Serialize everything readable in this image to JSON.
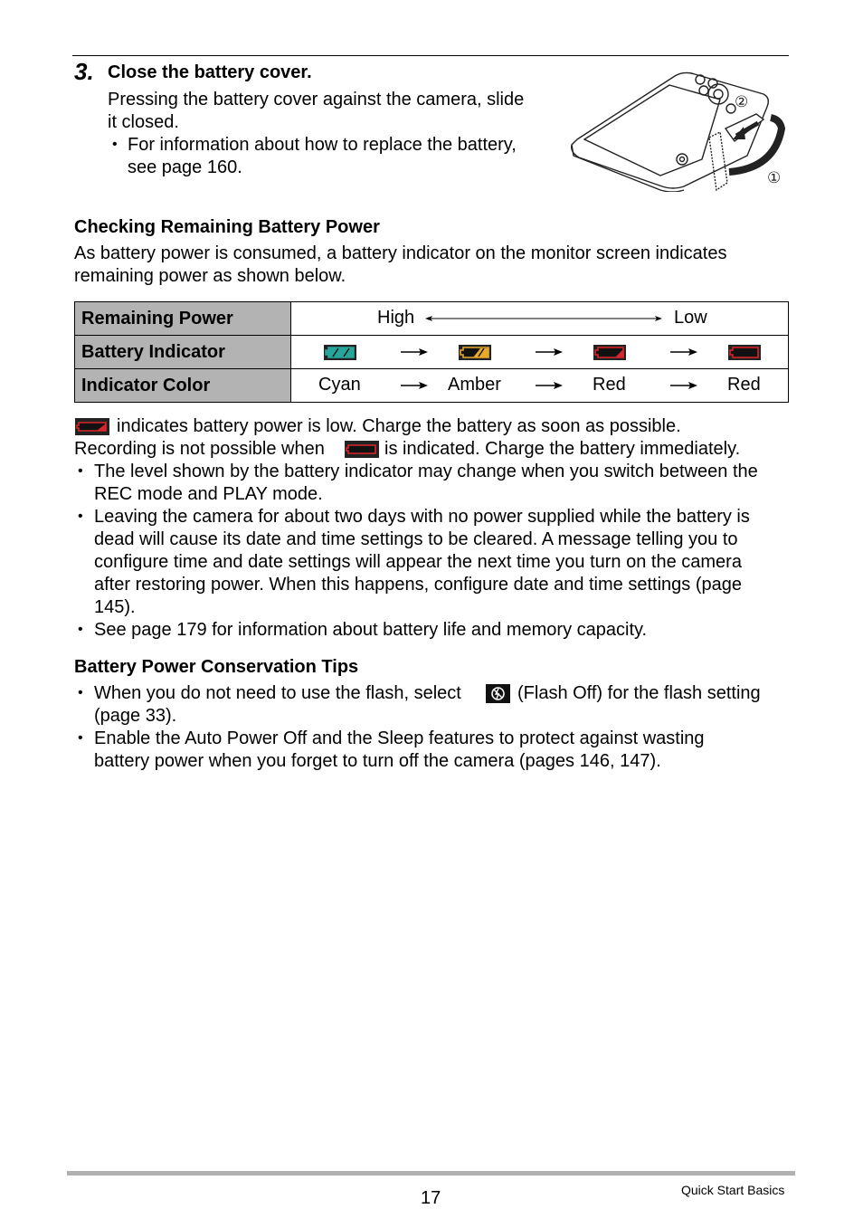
{
  "step": {
    "number": "3.",
    "title": "Close the battery cover.",
    "body_lines": [
      "Pressing the battery cover against the camera, slide",
      "it closed."
    ],
    "bullet_lines": [
      "For information about how to replace the battery,",
      "see page 160."
    ],
    "illustration": {
      "description": "camera-battery-cover-closing",
      "callouts": [
        "②",
        "①"
      ]
    }
  },
  "checking": {
    "heading": "Checking Remaining Battery Power",
    "intro_lines": [
      "As battery power is consumed, a battery indicator on the monitor screen indicates",
      "remaining power as shown below."
    ]
  },
  "table": {
    "rows": [
      {
        "header": "Remaining Power",
        "high": "High",
        "low": "Low"
      },
      {
        "header": "Battery Indicator",
        "indicators": [
          {
            "name": "battery-full-icon",
            "color": "#27a59a",
            "level": "full"
          },
          {
            "name": "battery-two-thirds-icon",
            "color": "#e8a92a",
            "level": "two-thirds"
          },
          {
            "name": "battery-low-icon",
            "color": "#d9252b",
            "level": "low"
          },
          {
            "name": "battery-empty-icon",
            "color": "#d9252b",
            "level": "empty"
          }
        ]
      },
      {
        "header": "Indicator Color",
        "colors": [
          "Cyan",
          "Amber",
          "Red",
          "Red"
        ]
      }
    ]
  },
  "notes": {
    "line1_after_icon": "indicates battery power is low. Charge the battery as soon as possible.",
    "line2_before_icon": "Recording is not possible when",
    "line2_after_icon": "is indicated. Charge the battery immediately.",
    "bullets": [
      [
        "The level shown by the battery indicator may change when you switch between the",
        "REC mode and PLAY mode."
      ],
      [
        "Leaving the camera for about two days with no power supplied while the battery is",
        "dead will cause its date and time settings to be cleared. A message telling you to",
        "configure time and date settings will appear the next time you turn on the camera",
        "after restoring power. When this happens, configure date and time settings (page",
        "145)."
      ],
      [
        "See page 179 for information about battery life and memory capacity."
      ]
    ]
  },
  "tips": {
    "heading": "Battery Power Conservation Tips",
    "bullet1_before_icon": "When you do not need to use the flash, select",
    "bullet1_after_icon": "(Flash Off) for the flash setting",
    "bullet1_line2": "(page 33).",
    "bullet2": [
      "Enable the Auto Power Off and the Sleep features to protect against wasting",
      "battery power when you forget to turn off the camera (pages 146, 147)."
    ]
  },
  "footer": {
    "page_number": "17",
    "section": "Quick Start Basics"
  }
}
